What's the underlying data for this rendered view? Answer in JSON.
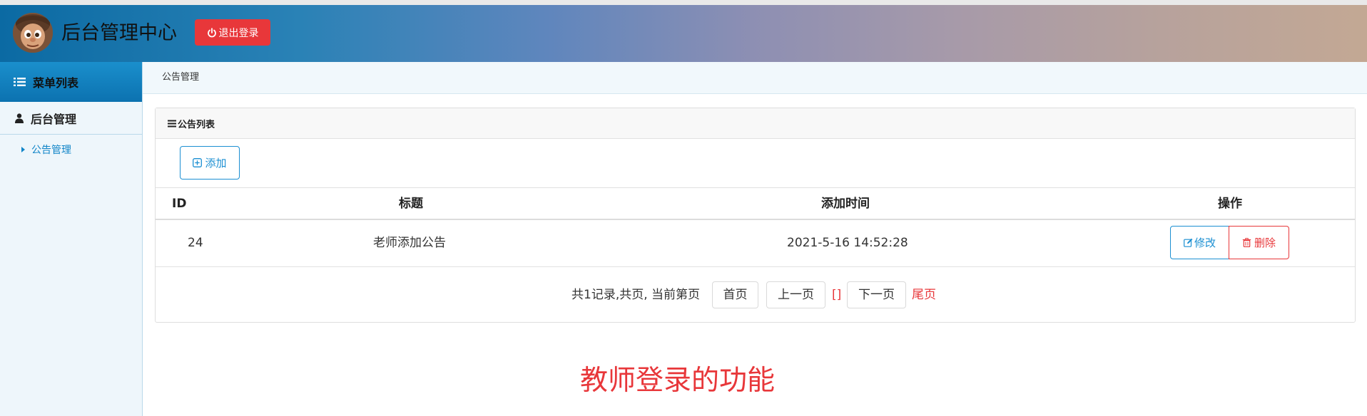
{
  "header": {
    "app_title": "后台管理中心",
    "logout_label": "退出登录"
  },
  "sidebar": {
    "menu_title": "菜单列表",
    "group_label": "后台管理",
    "items": [
      {
        "label": "公告管理"
      }
    ]
  },
  "breadcrumb": {
    "current": "公告管理"
  },
  "panel": {
    "title": "公告列表",
    "add_label": "添加",
    "table": {
      "columns": [
        "ID",
        "标题",
        "添加时间",
        "操作"
      ],
      "rows": [
        {
          "id": "24",
          "title": "老师添加公告",
          "added_at": "2021-5-16 14:52:28"
        }
      ],
      "edit_label": "修改",
      "delete_label": "删除"
    },
    "pager": {
      "summary": "共1记录,共页, 当前第页",
      "first": "首页",
      "prev": "上一页",
      "page_indicator": "[]",
      "next": "下一页",
      "last": "尾页"
    }
  },
  "caption": "教师登录的功能",
  "colors": {
    "accent_blue": "#1b8fd2",
    "danger_red": "#e8373a",
    "sidebar_bg": "#eef6fb"
  },
  "icons": {
    "logout": "power-icon",
    "menu": "list-icon",
    "group": "user-icon",
    "sub_item": "caret-right-icon",
    "panel_title": "hamburger-icon",
    "add": "plus-square-icon",
    "edit": "edit-icon",
    "delete": "trash-icon"
  }
}
